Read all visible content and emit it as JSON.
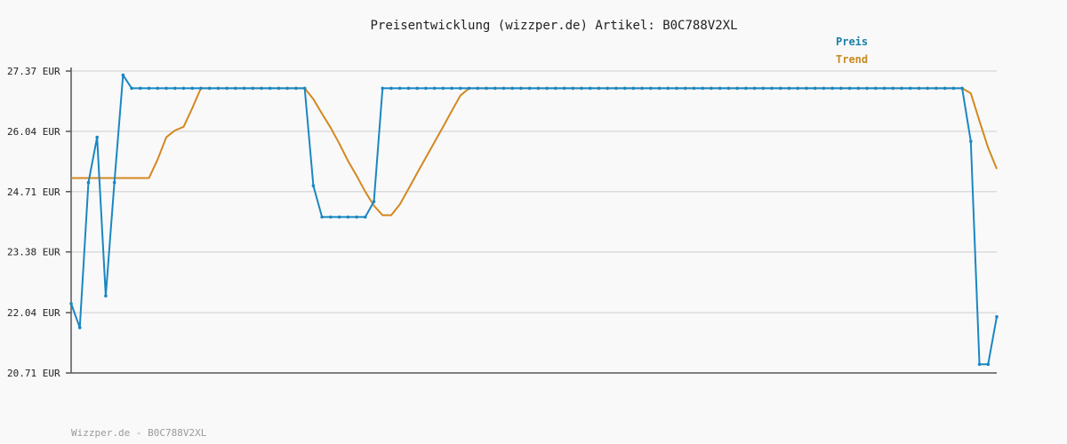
{
  "chart_data": {
    "type": "line",
    "title": "Preisentwicklung (wizzper.de) Artikel: B0C788V2XL",
    "footer": "Wizzper.de - B0C788V2XL",
    "y_unit": "EUR",
    "ylim": [
      20.71,
      27.37
    ],
    "yticks": [
      20.71,
      22.04,
      23.38,
      24.71,
      26.04,
      27.37
    ],
    "ytick_labels": [
      "20.71 EUR",
      "22.04 EUR",
      "23.38 EUR",
      "24.71 EUR",
      "26.04 EUR",
      "27.37 EUR"
    ],
    "grid": true,
    "legend_position": "top-right",
    "series": [
      {
        "name": "Preis",
        "color": "#1a87c2",
        "markers": true,
        "values": [
          22.24,
          21.71,
          24.91,
          25.91,
          22.41,
          24.91,
          27.28,
          26.99,
          26.99,
          26.99,
          26.99,
          26.99,
          26.99,
          26.99,
          26.99,
          26.99,
          26.99,
          26.99,
          26.99,
          26.99,
          26.99,
          26.99,
          26.99,
          26.99,
          26.99,
          26.99,
          26.99,
          26.99,
          24.84,
          24.15,
          24.15,
          24.15,
          24.15,
          24.15,
          24.15,
          24.49,
          26.99,
          26.99,
          26.99,
          26.99,
          26.99,
          26.99,
          26.99,
          26.99,
          26.99,
          26.99,
          26.99,
          26.99,
          26.99,
          26.99,
          26.99,
          26.99,
          26.99,
          26.99,
          26.99,
          26.99,
          26.99,
          26.99,
          26.99,
          26.99,
          26.99,
          26.99,
          26.99,
          26.99,
          26.99,
          26.99,
          26.99,
          26.99,
          26.99,
          26.99,
          26.99,
          26.99,
          26.99,
          26.99,
          26.99,
          26.99,
          26.99,
          26.99,
          26.99,
          26.99,
          26.99,
          26.99,
          26.99,
          26.99,
          26.99,
          26.99,
          26.99,
          26.99,
          26.99,
          26.99,
          26.99,
          26.99,
          26.99,
          26.99,
          26.99,
          26.99,
          26.99,
          26.99,
          26.99,
          26.99,
          26.99,
          26.99,
          26.99,
          26.99,
          25.82,
          20.9,
          20.9,
          21.95
        ]
      },
      {
        "name": "Trend",
        "color": "#d4881f",
        "markers": false,
        "values": [
          25.01,
          25.01,
          25.01,
          25.01,
          25.01,
          25.01,
          25.01,
          25.01,
          25.01,
          25.01,
          25.42,
          25.91,
          26.06,
          26.14,
          26.55,
          26.99,
          26.99,
          26.99,
          26.99,
          26.99,
          26.99,
          26.99,
          26.99,
          26.99,
          26.99,
          26.99,
          26.99,
          26.99,
          26.75,
          26.43,
          26.12,
          25.77,
          25.39,
          25.06,
          24.71,
          24.4,
          24.19,
          24.19,
          24.43,
          24.77,
          25.12,
          25.46,
          25.8,
          26.14,
          26.49,
          26.83,
          26.99,
          26.99,
          26.99,
          26.99,
          26.99,
          26.99,
          26.99,
          26.99,
          26.99,
          26.99,
          26.99,
          26.99,
          26.99,
          26.99,
          26.99,
          26.99,
          26.99,
          26.99,
          26.99,
          26.99,
          26.99,
          26.99,
          26.99,
          26.99,
          26.99,
          26.99,
          26.99,
          26.99,
          26.99,
          26.99,
          26.99,
          26.99,
          26.99,
          26.99,
          26.99,
          26.99,
          26.99,
          26.99,
          26.99,
          26.99,
          26.99,
          26.99,
          26.99,
          26.99,
          26.99,
          26.99,
          26.99,
          26.99,
          26.99,
          26.99,
          26.99,
          26.99,
          26.99,
          26.99,
          26.99,
          26.99,
          26.99,
          26.99,
          26.88,
          26.27,
          25.68,
          25.21
        ]
      }
    ]
  }
}
